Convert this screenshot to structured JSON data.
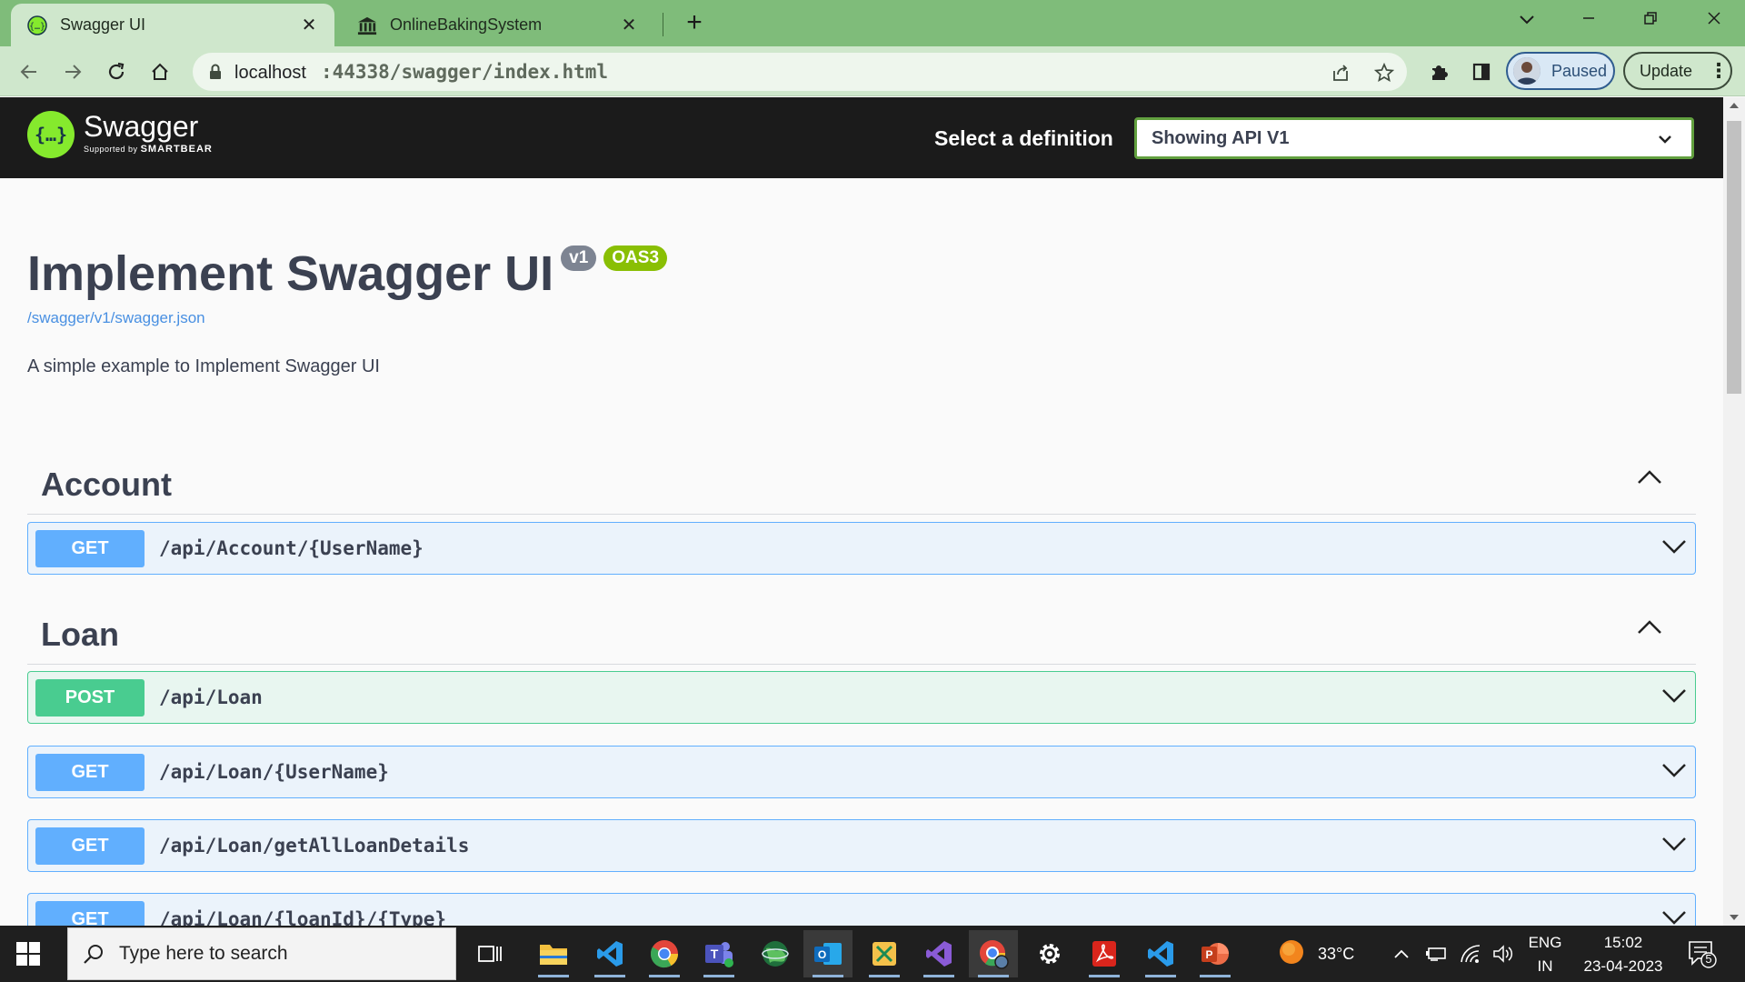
{
  "browser": {
    "tabs": [
      {
        "title": "Swagger UI",
        "active": true,
        "icon": "swagger-favicon"
      },
      {
        "title": "OnlineBakingSystem",
        "active": false,
        "icon": "bank-icon"
      }
    ],
    "address": {
      "host": "localhost",
      "port_path": ":44338/swagger/index.html"
    },
    "profile_label": "Paused",
    "update_label": "Update"
  },
  "swagger": {
    "brand": "Swagger",
    "supported_by": "Supported by",
    "smartbear": "SMARTBEAR",
    "definition_label": "Select a definition",
    "definition_value": "Showing API V1"
  },
  "info": {
    "title": "Implement Swagger UI",
    "version_badge": "v1",
    "oas_badge": "OAS3",
    "spec_link": "/swagger/v1/swagger.json",
    "description": "A simple example to Implement Swagger UI"
  },
  "tags": [
    {
      "name": "Account",
      "operations": [
        {
          "method": "GET",
          "path": "/api/Account/{UserName}"
        }
      ]
    },
    {
      "name": "Loan",
      "operations": [
        {
          "method": "POST",
          "path": "/api/Loan"
        },
        {
          "method": "GET",
          "path": "/api/Loan/{UserName}"
        },
        {
          "method": "GET",
          "path": "/api/Loan/getAllLoanDetails"
        },
        {
          "method": "GET",
          "path": "/api/Loan/{loanId}/{Type}"
        }
      ]
    }
  ],
  "taskbar": {
    "search_placeholder": "Type here to search",
    "weather": "33°C",
    "lang_top": "ENG",
    "lang_bottom": "IN",
    "time": "15:02",
    "date": "23-04-2023",
    "notification_count": "5"
  },
  "colors": {
    "get": "#61affe",
    "post": "#49cc90",
    "swagger_green": "#85ea2d",
    "chrome_theme": "#7fbc7a"
  }
}
